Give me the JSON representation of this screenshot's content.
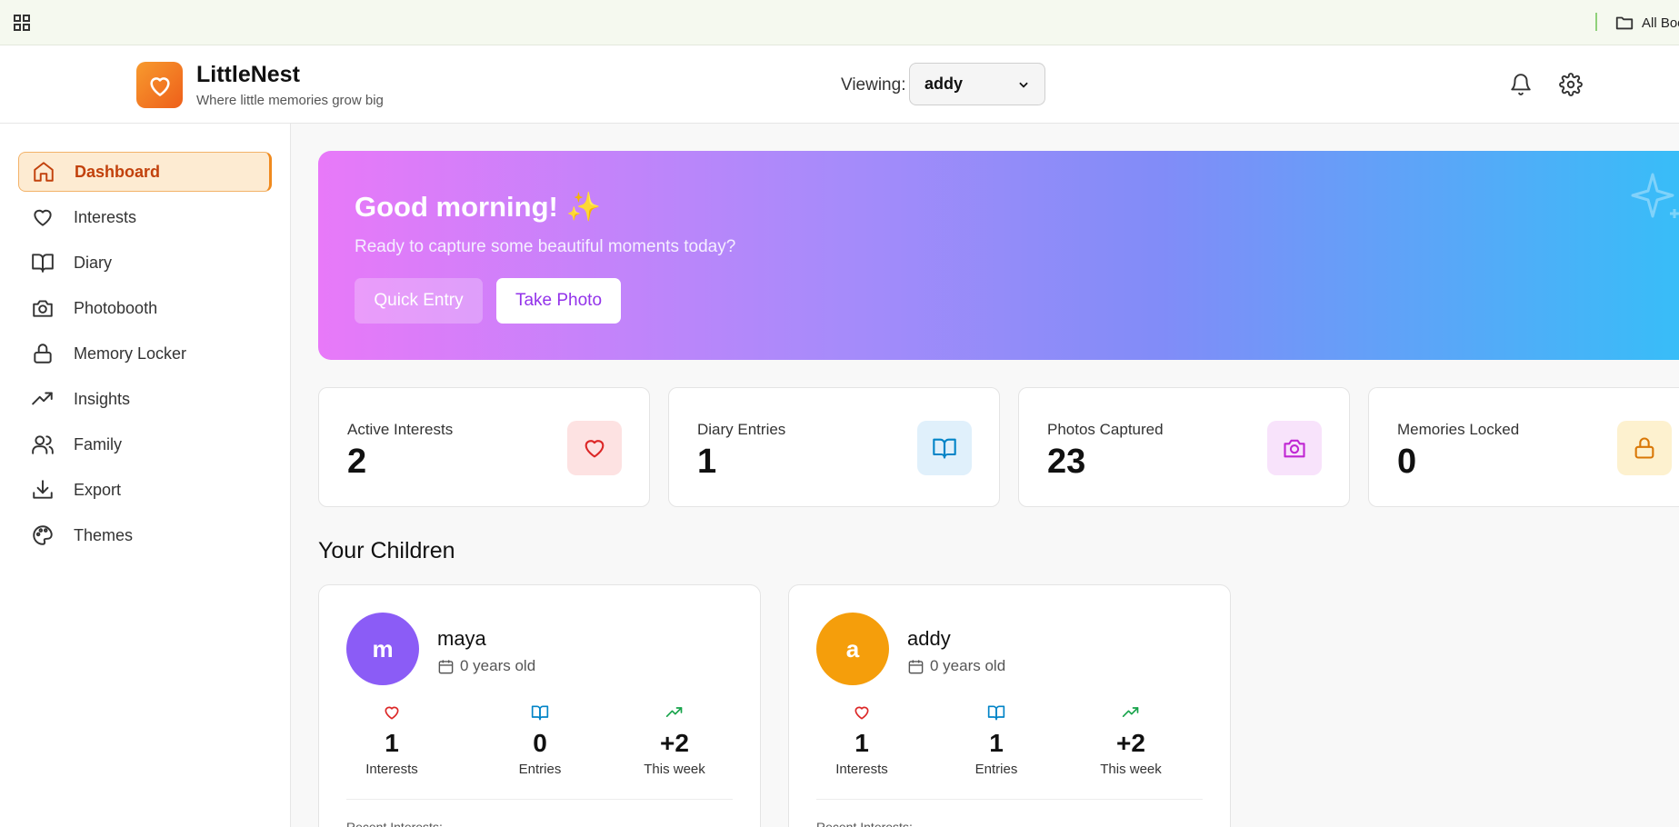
{
  "browser": {
    "all_bookmarks": "All Bookmarks"
  },
  "header": {
    "brand_name": "LittleNest",
    "brand_tagline": "Where little memories grow big",
    "viewing_label": "Viewing:",
    "viewing_selected": "addy"
  },
  "sidebar": {
    "items": [
      {
        "label": "Dashboard",
        "icon": "home-icon",
        "active": true
      },
      {
        "label": "Interests",
        "icon": "heart-icon"
      },
      {
        "label": "Diary",
        "icon": "book-open-icon"
      },
      {
        "label": "Photobooth",
        "icon": "camera-icon"
      },
      {
        "label": "Memory Locker",
        "icon": "lock-icon"
      },
      {
        "label": "Insights",
        "icon": "trending-up-icon"
      },
      {
        "label": "Family",
        "icon": "users-icon"
      },
      {
        "label": "Export",
        "icon": "download-icon"
      },
      {
        "label": "Themes",
        "icon": "palette-icon"
      }
    ]
  },
  "hero": {
    "greeting": "Good morning!",
    "greeting_emoji": "✨",
    "subtitle": "Ready to capture some beautiful moments today?",
    "quick_entry_label": "Quick Entry",
    "take_photo_label": "Take Photo"
  },
  "stats": [
    {
      "label": "Active Interests",
      "value": "2",
      "icon": "heart-icon",
      "color": "#dc2626",
      "bg": "#fde2e2"
    },
    {
      "label": "Diary Entries",
      "value": "1",
      "icon": "book-open-icon",
      "color": "#0284c7",
      "bg": "#e0f0fb"
    },
    {
      "label": "Photos Captured",
      "value": "23",
      "icon": "camera-icon",
      "color": "#c026d3",
      "bg": "#f8e3fb"
    },
    {
      "label": "Memories Locked",
      "value": "0",
      "icon": "lock-icon",
      "color": "#d97706",
      "bg": "#fdf1cf"
    }
  ],
  "children_section": {
    "title": "Your Children",
    "children": [
      {
        "initial": "m",
        "name": "maya",
        "age": "0 years old",
        "avatar_color": "#8b5cf6",
        "interests_value": "1",
        "interests_label": "Interests",
        "entries_value": "0",
        "entries_label": "Entries",
        "week_value": "+2",
        "week_label": "This week",
        "recent_label": "Recent Interests:"
      },
      {
        "initial": "a",
        "name": "addy",
        "age": "0 years old",
        "avatar_color": "#f59e0b",
        "interests_value": "1",
        "interests_label": "Interests",
        "entries_value": "1",
        "entries_label": "Entries",
        "week_value": "+2",
        "week_label": "This week",
        "recent_label": "Recent Interests:"
      }
    ]
  },
  "colors": {
    "accent": "#f08a1e",
    "heart": "#dc2626",
    "book": "#0284c7",
    "trend": "#16a34a"
  }
}
